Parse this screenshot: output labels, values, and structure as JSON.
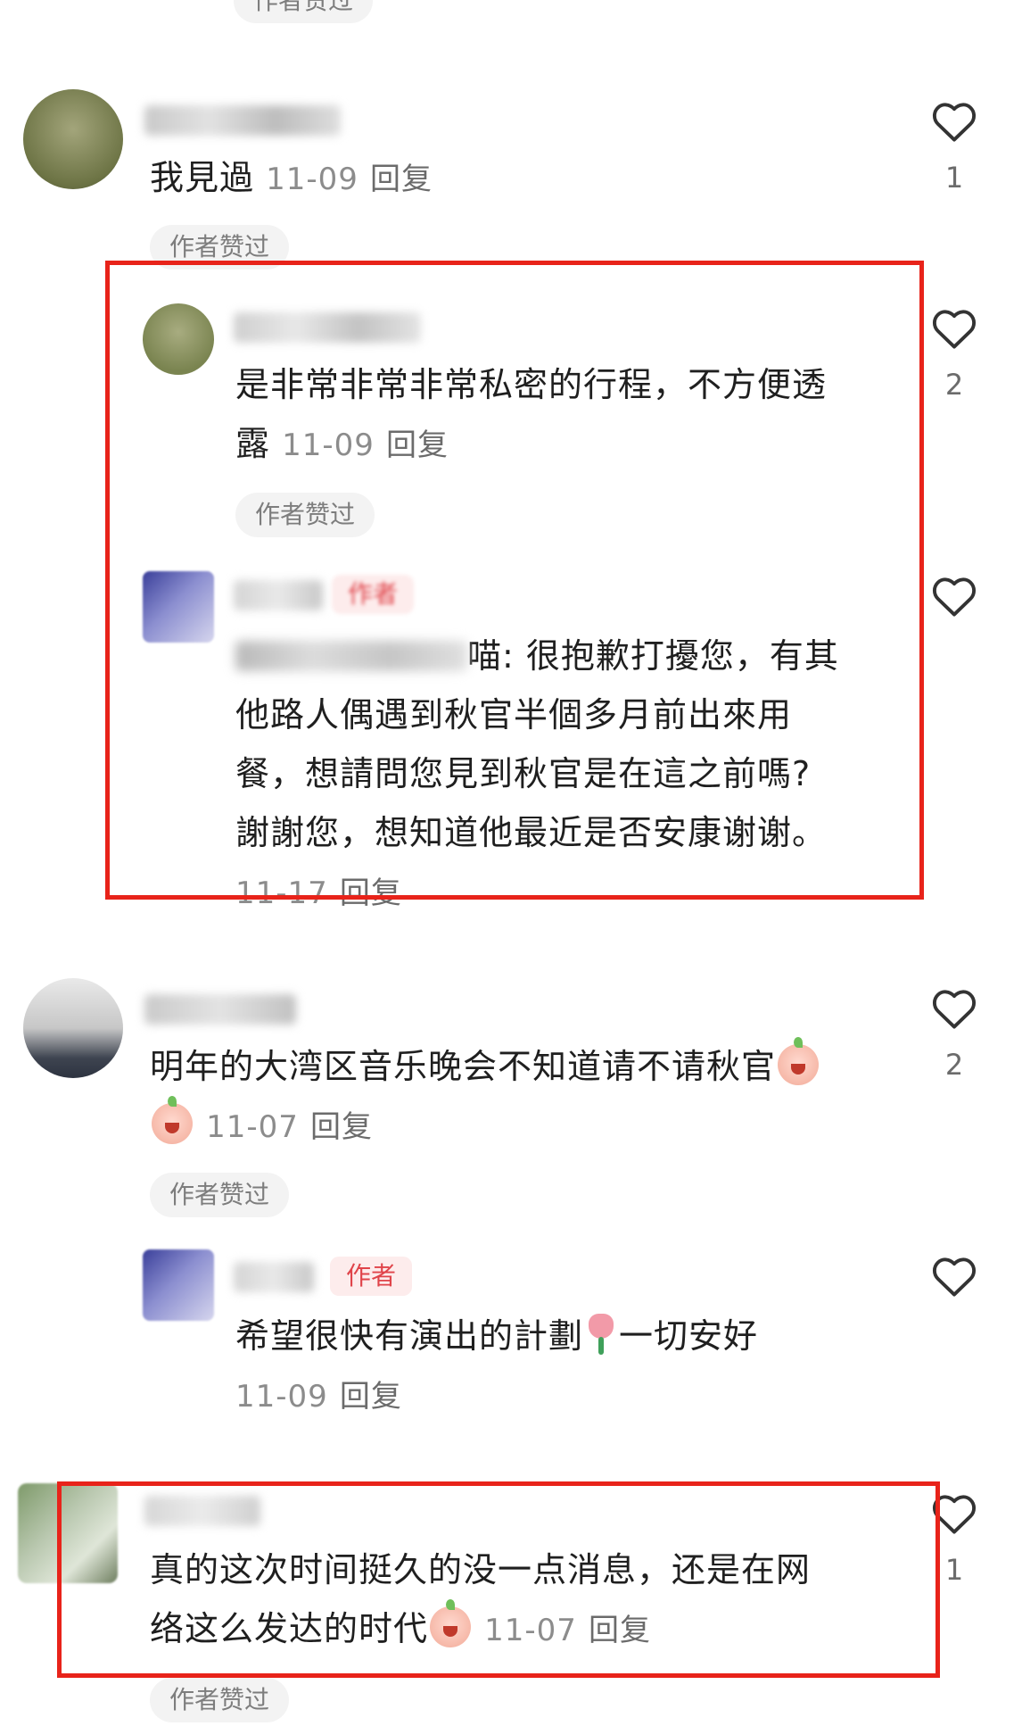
{
  "colors": {
    "highlight_box": "#e8231a",
    "author_tag": "#e0444a",
    "meta_text": "#8c8c8c"
  },
  "top_partial": {
    "liked_badge": "作者赞过"
  },
  "comments": [
    {
      "text": "我見過",
      "date": "11-09",
      "reply": "回复",
      "likes": "1",
      "liked_badge": "作者赞过",
      "replies": [
        {
          "text_line1": "是非常非常非常私密的行程，不方便透",
          "text_line2": "露",
          "date": "11-09",
          "reply": "回复",
          "likes": "2",
          "liked_badge": "作者赞过"
        },
        {
          "author_tag": "作者",
          "quote_tail": "喵: ",
          "text_line1": "很抱歉打擾您，有其",
          "text_line2": "他路人偶遇到秋官半個多月前出來用",
          "text_line3": "餐，想請問您見到秋官是在這之前嗎?",
          "text_line4": "謝謝您，想知道他最近是否安康谢谢。",
          "date": "11-17",
          "reply": "回复"
        }
      ]
    },
    {
      "text_line1": "明年的大湾区音乐晚会不知道请不请秋官",
      "date": "11-07",
      "reply": "回复",
      "likes": "2",
      "liked_badge": "作者赞过",
      "replies": [
        {
          "author_tag": "作者",
          "text_before": "希望很快有演出的計劃",
          "text_after": "一切安好",
          "date": "11-09",
          "reply": "回复"
        }
      ]
    },
    {
      "text_line1": "真的这次时间挺久的没一点消息，还是在网",
      "text_line2": "络这么发达的时代",
      "date": "11-07",
      "reply": "回复",
      "likes": "1",
      "liked_badge": "作者赞过"
    }
  ],
  "icons": {
    "like": "heart-outline-icon",
    "emoji_peach": "peach-face-emoji-icon",
    "emoji_tulip": "tulip-emoji-icon",
    "emoji_crying": "crying-face-emoji-icon"
  }
}
